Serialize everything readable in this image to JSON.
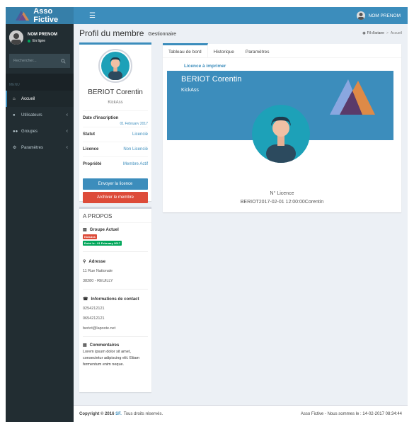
{
  "app": {
    "brand": "Asso Fictive"
  },
  "topbar": {
    "menu_icon": "hamburger-icon",
    "user_name": "NOM PRENOM"
  },
  "sidebar": {
    "user_name": "NOM PRENOM",
    "user_status": "En ligne",
    "search_placeholder": "Rechercher...",
    "menu_header": "MENU",
    "items": [
      {
        "label": "Accueil",
        "icon": "home-icon"
      },
      {
        "label": "Utilisateurs",
        "icon": "user-icon"
      },
      {
        "label": "Groupes",
        "icon": "users-icon"
      },
      {
        "label": "Paramètres",
        "icon": "gear-icon"
      }
    ]
  },
  "header": {
    "title": "Profil du membre",
    "subtitle": "Gestionnaire",
    "breadcrumb_root": "Fil d'ariane",
    "breadcrumb_current": "Accueil"
  },
  "profile": {
    "name": "BERIOT Corentin",
    "job": "KickAss",
    "date_label": "Date d'inscription",
    "date_value": "01 February 2017",
    "status_label": "Statut",
    "status_value": "Licencié",
    "licence_label": "Licence",
    "licence_value": "Non Licencié",
    "propriete_label": "Propriété",
    "propriete_value": "Membre Actif",
    "send_button": "Envoyer la licence",
    "archive_button": "Archiver le membre"
  },
  "about": {
    "title": "A PROPOS",
    "group_heading": "Groupe Actuel",
    "group_label": "KickAss",
    "group_entry": "Entré le : 01 February 2017",
    "address_heading": "Adresse",
    "address_line1": "11 Rue Nationale",
    "address_line2": "38280 - REUILLY",
    "contact_heading": "Informations de contact",
    "phone1": "0254212121",
    "phone2": "0654212121",
    "email": "beriot@laposte.net",
    "comments_heading": "Commentaires",
    "comments_text": "Lorem ipsum dolor sit amet, consectetur adipiscing elit. Etiam fermentum enim neque."
  },
  "main": {
    "tabs": [
      "Tableau de bord",
      "Historique",
      "Paramètres"
    ],
    "licence_link": "Licence à imprimer",
    "card_name": "BERIOT Corentin",
    "card_sub": "KickAss",
    "licence_no_label": "N° Licence",
    "licence_no_value": "BERIOT2017-02-01 12:00:00Corentin"
  },
  "footer": {
    "copyright": "Copyright © 2016",
    "brand_link": "SF.",
    "rights": "Tous droits réservés.",
    "right_text": "Asso Fictive - Nous sommes le : 14-02-2017 08:34:44"
  },
  "colors": {
    "accent": "#3c8dbc",
    "sidebar": "#222d32",
    "danger": "#dd4b39",
    "success": "#00a65a"
  }
}
